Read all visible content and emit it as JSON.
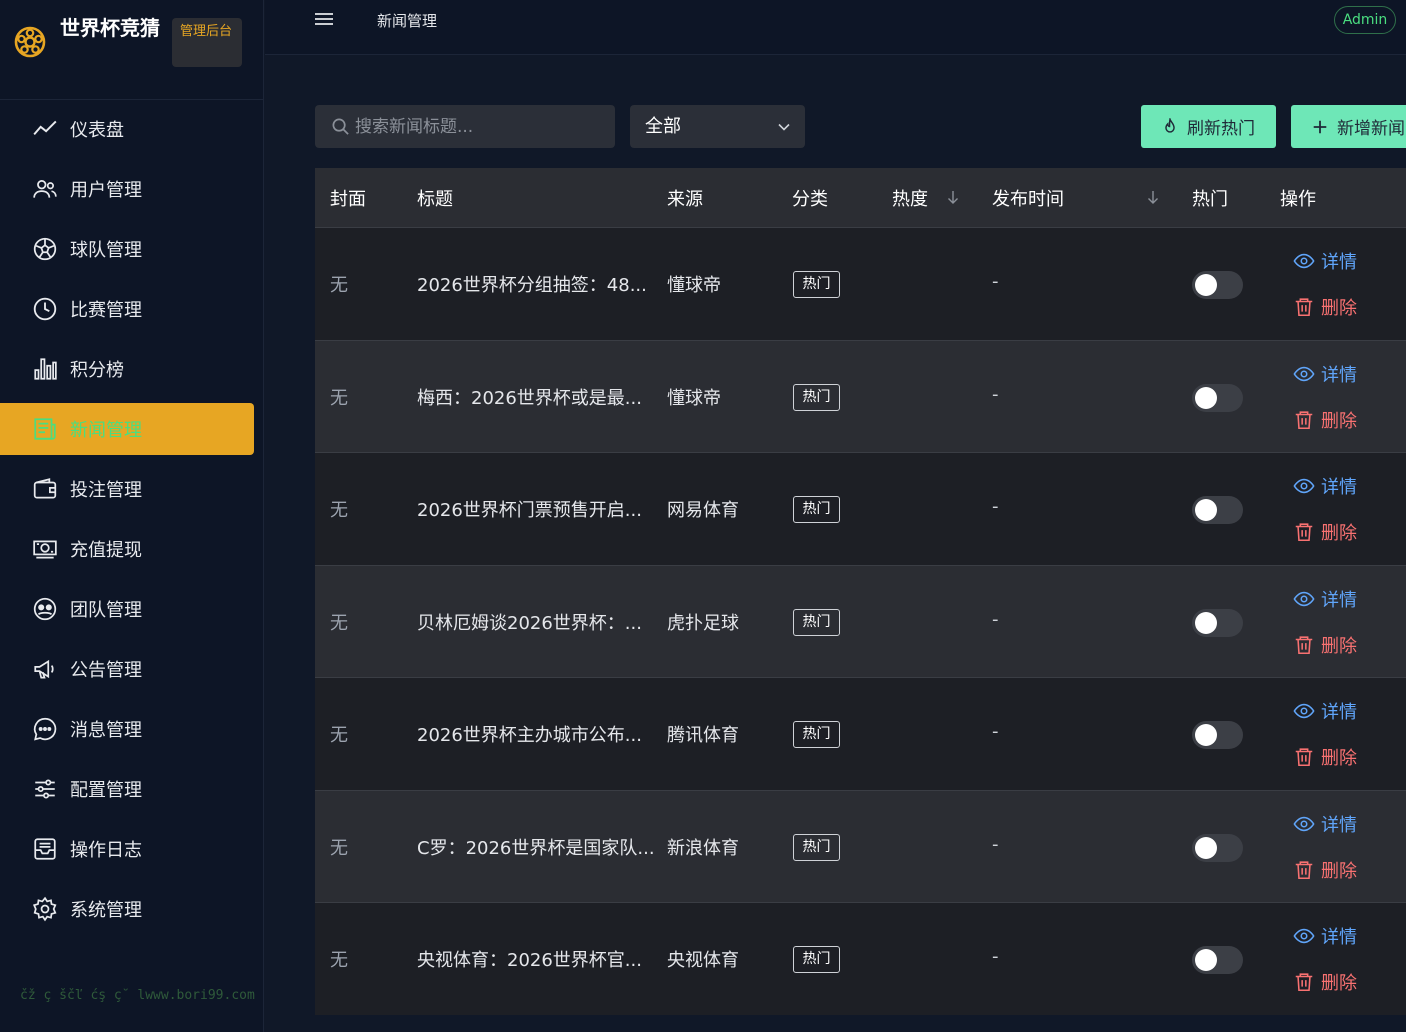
{
  "brand": {
    "name": "世界杯竞猜",
    "tag": "管理后台"
  },
  "nav": [
    {
      "key": "dashboard",
      "label": "仪表盘",
      "icon": "trend-icon"
    },
    {
      "key": "users",
      "label": "用户管理",
      "icon": "users-icon"
    },
    {
      "key": "teams",
      "label": "球队管理",
      "icon": "ball-icon"
    },
    {
      "key": "matches",
      "label": "比赛管理",
      "icon": "clock-icon"
    },
    {
      "key": "standings",
      "label": "积分榜",
      "icon": "bar-chart-icon"
    },
    {
      "key": "news",
      "label": "新闻管理",
      "icon": "newspaper-icon",
      "active": true
    },
    {
      "key": "bets",
      "label": "投注管理",
      "icon": "wallet-icon"
    },
    {
      "key": "recharge",
      "label": "充值提现",
      "icon": "money-icon"
    },
    {
      "key": "teamsorg",
      "label": "团队管理",
      "icon": "team-icon"
    },
    {
      "key": "notices",
      "label": "公告管理",
      "icon": "megaphone-icon"
    },
    {
      "key": "messages",
      "label": "消息管理",
      "icon": "chat-icon"
    },
    {
      "key": "config",
      "label": "配置管理",
      "icon": "sliders-icon"
    },
    {
      "key": "logs",
      "label": "操作日志",
      "icon": "inbox-icon"
    },
    {
      "key": "system",
      "label": "系统管理",
      "icon": "gear-icon"
    }
  ],
  "watermark": "čž ç ščľ ćş ç˘ lwww.bori99.com",
  "topbar": {
    "breadcrumb": "新闻管理",
    "user": "Admin"
  },
  "toolbar": {
    "search_placeholder": "搜索新闻标题...",
    "category_value": "全部",
    "refresh_label": "刷新热门",
    "add_label": "新增新闻"
  },
  "table": {
    "columns": [
      "封面",
      "标题",
      "来源",
      "分类",
      "热度",
      "发布时间",
      "热门",
      "操作"
    ],
    "detail_label": "详情",
    "delete_label": "删除",
    "rows": [
      {
        "cover": "无",
        "title": "2026世界杯分组抽签：48...",
        "source": "懂球帝",
        "category": "热门",
        "heat": "",
        "published": "-",
        "hot": false
      },
      {
        "cover": "无",
        "title": "梅西：2026世界杯或是最...",
        "source": "懂球帝",
        "category": "热门",
        "heat": "",
        "published": "-",
        "hot": false
      },
      {
        "cover": "无",
        "title": "2026世界杯门票预售开启...",
        "source": "网易体育",
        "category": "热门",
        "heat": "",
        "published": "-",
        "hot": false
      },
      {
        "cover": "无",
        "title": "贝林厄姆谈2026世界杯：...",
        "source": "虎扑足球",
        "category": "热门",
        "heat": "",
        "published": "-",
        "hot": false
      },
      {
        "cover": "无",
        "title": "2026世界杯主办城市公布...",
        "source": "腾讯体育",
        "category": "热门",
        "heat": "",
        "published": "-",
        "hot": false
      },
      {
        "cover": "无",
        "title": "C罗：2026世界杯是国家队...",
        "source": "新浪体育",
        "category": "热门",
        "heat": "",
        "published": "-",
        "hot": false
      },
      {
        "cover": "无",
        "title": "央视体育：2026世界杯官...",
        "source": "央视体育",
        "category": "热门",
        "heat": "",
        "published": "-",
        "hot": false
      }
    ]
  },
  "colors": {
    "accent": "#e7a623",
    "green": "#6ee7b7",
    "detail": "#60a5fa",
    "delete": "#f87171"
  }
}
